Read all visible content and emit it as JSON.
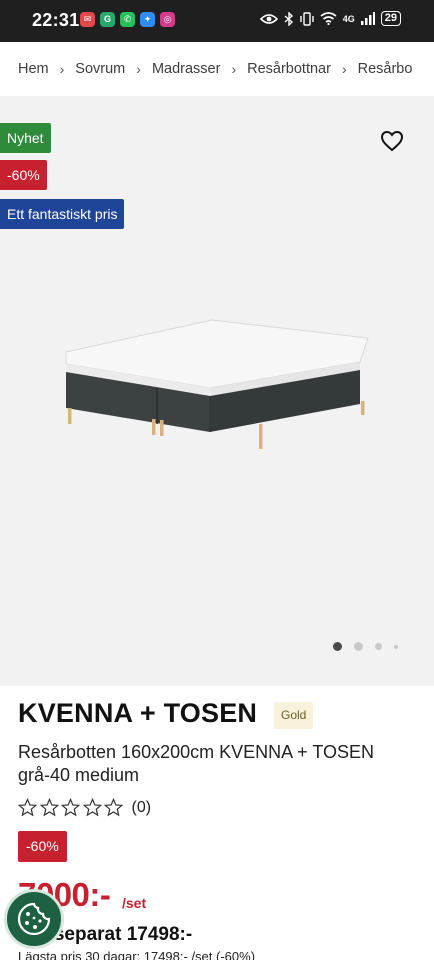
{
  "status_bar": {
    "time": "22:31",
    "network": "4G",
    "battery": "29",
    "apps": [
      {
        "icon": "notification-app-icon",
        "color": "#e0484a",
        "glyph": "✉"
      },
      {
        "icon": "chat-app-icon",
        "color": "#27a86a",
        "glyph": "G"
      },
      {
        "icon": "whatsapp-icon",
        "color": "#25c05a",
        "glyph": "✆"
      },
      {
        "icon": "messenger-icon",
        "color": "#2f8cf0",
        "glyph": "✦"
      },
      {
        "icon": "instagram-icon",
        "color": "#d63a8d",
        "glyph": "◎"
      }
    ]
  },
  "breadcrumb": [
    "Hem",
    "Sovrum",
    "Madrasser",
    "Resårbottnar",
    "Resårbo"
  ],
  "badges": {
    "new": "Nyhet",
    "discount": "-60%",
    "price_label": "Ett fantastiskt pris"
  },
  "gallery": {
    "image_count": 4,
    "active_index": 0
  },
  "product": {
    "title": "KVENNA + TOSEN",
    "tier": "Gold",
    "subtitle": "Resårbotten 160x200cm KVENNA + TOSEN grå-40 medium",
    "rating_stars": 0,
    "rating_count": "(0)",
    "discount": "-60%",
    "price": "7000:-",
    "price_unit": "/set",
    "separate_price": "s separat 17498:-",
    "lowest_price": "Lägsta pris 30 dagar: 17498:- /set (-60%)"
  },
  "colors": {
    "accent_red": "#c7202f",
    "new_green": "#2e8b3a",
    "price_blue": "#1f4599",
    "gold_bg": "#f8f2da",
    "cookie_green": "#1d6142"
  }
}
